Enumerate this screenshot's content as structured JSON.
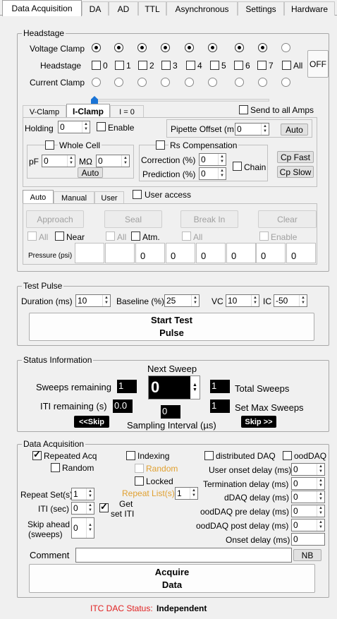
{
  "tabs": [
    "Data Acquisition",
    "DA",
    "AD",
    "TTL",
    "Asynchronous",
    "Settings",
    "Hardware"
  ],
  "headstage": {
    "title": "Headstage",
    "voltage_clamp_label": "Voltage Clamp",
    "headstage_label": "Headstage",
    "current_clamp_label": "Current Clamp",
    "hs_numbers": [
      "0",
      "1",
      "2",
      "3",
      "4",
      "5",
      "6",
      "7"
    ],
    "all_label": "All",
    "off_label": "OFF",
    "vclamp_selected": [
      true,
      true,
      true,
      true,
      true,
      true,
      true,
      true,
      false
    ]
  },
  "clamp_tabs": [
    "V-Clamp",
    "I-Clamp",
    "I = 0"
  ],
  "send_all_amps": "Send to all Amps",
  "holding_label": "Holding",
  "holding_value": "0",
  "enable_label": "Enable",
  "pipette_offset_label": "Pipette Offset (m",
  "pipette_offset_value": "0",
  "auto_label": "Auto",
  "whole_cell_label": "Whole Cell",
  "pf_label": "pF",
  "pf_value": "0",
  "mohm_label": "MΩ",
  "mohm_value": "0",
  "auto2_label": "Auto",
  "rs_comp_label": "Rs Compensation",
  "correction_label": "Correction (%)",
  "correction_value": "0",
  "prediction_label": "Prediction (%)",
  "prediction_value": "0",
  "chain_label": "Chain",
  "cp_fast": "Cp Fast",
  "cp_slow": "Cp Slow",
  "pressure_tabs": [
    "Auto",
    "Manual",
    "User"
  ],
  "user_access": "User access",
  "approach": "Approach",
  "seal": "Seal",
  "break_in": "Break In",
  "clear": "Clear",
  "all1": "All",
  "near": "Near",
  "all2": "All",
  "atm": "Atm.",
  "all3": "All",
  "enable2": "Enable",
  "pressure_label": "Pressure (psi)",
  "pressure_values": [
    "",
    "",
    "0",
    "0",
    "0",
    "0",
    "0",
    "0"
  ],
  "test_pulse": {
    "title": "Test Pulse",
    "duration_label": "Duration (ms)",
    "duration": "10",
    "baseline_label": "Baseline (%)",
    "baseline": "25",
    "vc_label": "VC",
    "vc": "10",
    "ic_label": "IC",
    "ic": "-50",
    "start_line1": "Start Test",
    "start_line2": "Pulse"
  },
  "status": {
    "title": "Status Information",
    "next_sweep": "Next Sweep",
    "next_sweep_value": "0",
    "sweeps_remaining_label": "Sweeps remaining",
    "sweeps_remaining": "1",
    "total_sweeps": "1",
    "total_sweeps_label": "Total Sweeps",
    "iti_remaining_label": "ITI remaining (s)",
    "iti_remaining": "0.0",
    "sampling_value": "0",
    "sampling_label": "Sampling Interval (µs)",
    "max_sweeps": "1",
    "max_sweeps_label": "Set Max Sweeps",
    "skip_back": "<<Skip",
    "skip_fwd": "Skip >>"
  },
  "daq": {
    "title": "Data Acquisition",
    "repeated_acq": "Repeated Acq",
    "random": "Random",
    "indexing": "Indexing",
    "random2": "Random",
    "locked": "Locked",
    "distributed_daq": "distributed DAQ",
    "ooddaq": "oodDAQ",
    "repeat_sets_label": "Repeat Set(s)",
    "repeat_sets": "1",
    "repeat_lists_label": "Repeat List(s)",
    "repeat_lists": "1",
    "iti_label": "ITI (sec)",
    "iti": "0",
    "get_iti_line1": "Get",
    "get_iti_line2": "set ITI",
    "skip_ahead_line1": "Skip ahead",
    "skip_ahead_line2": "(sweeps)",
    "skip_ahead": "0",
    "user_onset_label": "User onset delay (ms)",
    "user_onset": "0",
    "termination_label": "Termination delay (ms)",
    "termination": "0",
    "ddaq_label": "dDAQ delay (ms)",
    "ddaq": "0",
    "ooddaq_pre_label": "oodDAQ pre delay (ms)",
    "ooddaq_pre": "0",
    "ooddaq_post_label": "oodDAQ post delay (ms)",
    "ooddaq_post": "0",
    "onset_label": "Onset delay (ms)",
    "onset": "0",
    "comment_label": "Comment",
    "comment_value": "",
    "nb": "NB",
    "acquire_line1": "Acquire",
    "acquire_line2": "Data"
  },
  "itc_status_label": "ITC DAC Status:",
  "itc_status_value": "Independent"
}
